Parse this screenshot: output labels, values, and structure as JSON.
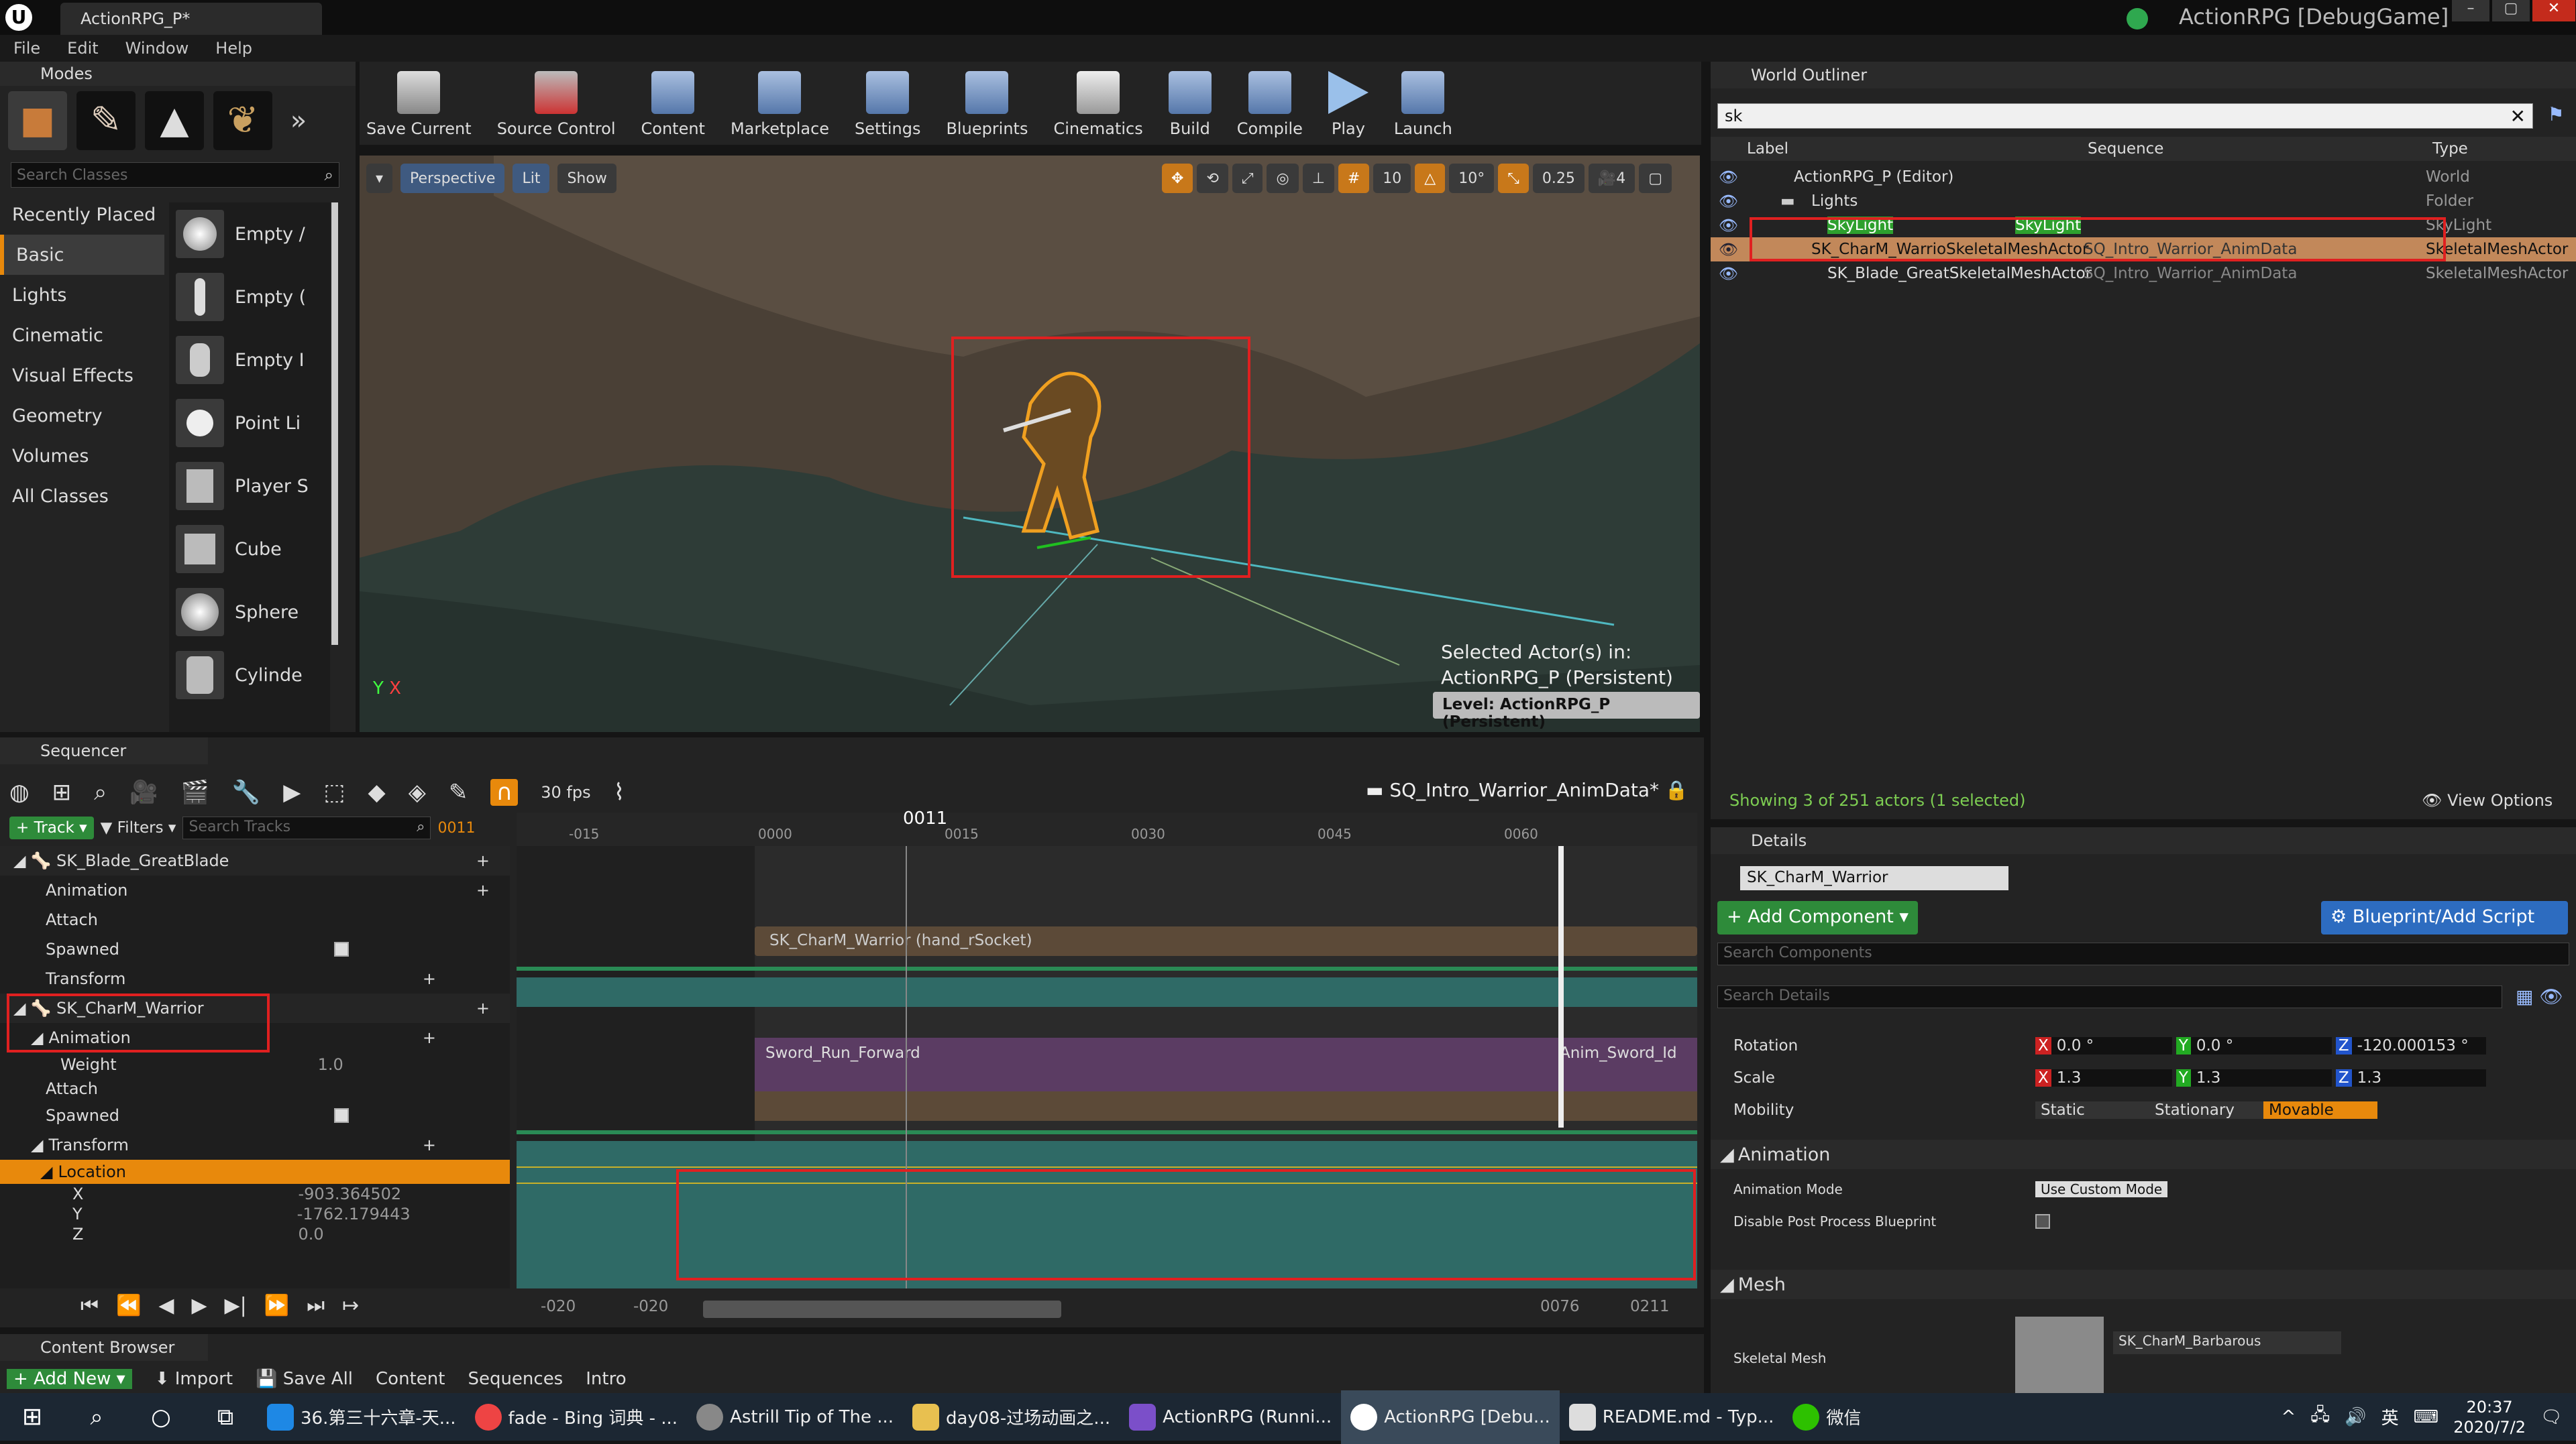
{
  "app": {
    "tab_title": "ActionRPG_P*",
    "window_title": "ActionRPG [DebugGame]"
  },
  "menu": [
    "File",
    "Edit",
    "Window",
    "Help"
  ],
  "modes": {
    "title": "Modes",
    "search_placeholder": "Search Classes",
    "categories": [
      "Recently Placed",
      "Basic",
      "Lights",
      "Cinematic",
      "Visual Effects",
      "Geometry",
      "Volumes",
      "All Classes"
    ],
    "items": [
      "Empty /",
      "Empty (",
      "Empty I",
      "Point Li",
      "Player S",
      "Cube",
      "Sphere",
      "Cylinde"
    ]
  },
  "toolbar": [
    "Save Current",
    "Source Control",
    "Content",
    "Marketplace",
    "Settings",
    "Blueprints",
    "Cinematics",
    "Build",
    "Compile",
    "Play",
    "Launch"
  ],
  "viewport": {
    "perspective": "Perspective",
    "lit": "Lit",
    "show": "Show",
    "snap_grid": "10",
    "snap_rot": "10°",
    "snap_scale": "0.25",
    "cam_speed": "4",
    "selected_line1": "Selected Actor(s) in:",
    "selected_line2": "ActionRPG_P (Persistent)",
    "level": "Level:  ActionRPG_P (Persistent)"
  },
  "outliner": {
    "title": "World Outliner",
    "search": "sk",
    "col_label": "Label",
    "col_seq": "Sequence",
    "col_type": "Type",
    "rows": [
      {
        "label": "ActionRPG_P (Editor)",
        "seq": "",
        "type": "World"
      },
      {
        "label": "Lights",
        "seq": "",
        "type": "Folder"
      },
      {
        "label": "SkyLight",
        "seq": "SkyLight",
        "type": "SkyLight"
      },
      {
        "label": "SK_CharM_WarrioSkeletalMeshActor",
        "seq": "SQ_Intro_Warrior_AnimData",
        "type": "SkeletalMeshActor"
      },
      {
        "label": "SK_Blade_GreatSkeletalMeshActor",
        "seq": "SQ_Intro_Warrior_AnimData",
        "type": "SkeletalMeshActor"
      }
    ],
    "status": "Showing 3 of 251 actors (1 selected)",
    "view_options": "View Options"
  },
  "sequencer": {
    "title": "Sequencer",
    "fps": "30 fps",
    "seq_name": "SQ_Intro_Warrior_AnimData*",
    "track_btn": "Track",
    "filters": "Filters",
    "search_placeholder": "Search Tracks",
    "frame": "0011",
    "playhead": "0011",
    "ticks": [
      "-015",
      "0000",
      "0015",
      "0030",
      "0045",
      "0060"
    ],
    "tracks": [
      "SK_Blade_GreatBlade",
      "Animation",
      "Attach",
      "Spawned",
      "Transform",
      "SK_CharM_Warrior",
      "Animation",
      "Weight",
      "Attach",
      "Spawned",
      "Transform",
      "Location",
      "X",
      "Y",
      "Z"
    ],
    "weight": "1.0",
    "loc_x": "-903.364502",
    "loc_y": "-1762.179443",
    "loc_z": "0.0",
    "sections": {
      "attach": "SK_CharM_Warrior (hand_rSocket)",
      "anim1": "Sword_Run_Forward",
      "anim2": "Anim_Sword_Id"
    },
    "range": [
      "-020",
      "-020",
      "0076",
      "0211"
    ]
  },
  "details": {
    "title": "Details",
    "actor": "SK_CharM_Warrior",
    "add_component": "Add Component",
    "blueprint": "Blueprint/Add Script",
    "search_components": "Search Components",
    "search_details": "Search Details",
    "rotation": {
      "label": "Rotation",
      "x": "0.0 °",
      "y": "0.0 °",
      "z": "-120.000153 °"
    },
    "scale": {
      "label": "Scale",
      "x": "1.3",
      "y": "1.3",
      "z": "1.3"
    },
    "mobility": {
      "label": "Mobility",
      "static": "Static",
      "stationary": "Stationary",
      "movable": "Movable"
    },
    "animation_section": "Animation",
    "anim_mode_label": "Animation Mode",
    "anim_mode": "Use Custom Mode",
    "disable_pp": "Disable Post Process Blueprint",
    "mesh_section": "Mesh",
    "skel_mesh_label": "Skeletal Mesh",
    "skel_mesh": "SK_CharM_Barbarous"
  },
  "content_browser": {
    "title": "Content Browser",
    "add_new": "Add New",
    "import": "Import",
    "save_all": "Save All",
    "path": [
      "Content",
      "Sequences",
      "Intro"
    ]
  },
  "taskbar": {
    "apps": [
      "36.第三十六章-天...",
      "fade - Bing 词典 - ...",
      "Astrill Tip of The ...",
      "day08-过场动画之...",
      "ActionRPG (Runni...",
      "ActionRPG [Debu...",
      "README.md - Typ...",
      "微信"
    ],
    "ime": "英",
    "time": "20:37",
    "date": "2020/7/2"
  },
  "colors": {
    "selection_orange": "#e8890c",
    "annotation_red": "#e02020",
    "track_teal": "#2f6a66",
    "anim_purple": "#5b3c63",
    "movable_orange": "#e8890c"
  }
}
